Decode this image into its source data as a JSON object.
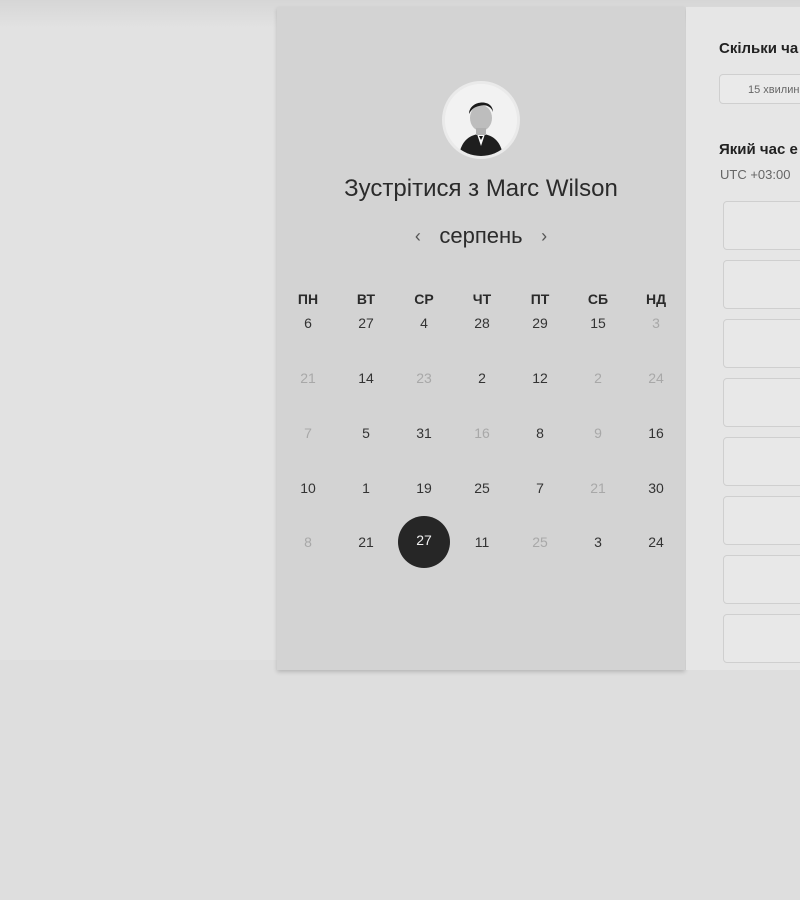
{
  "meeting": {
    "title_prefix": "Зустрітися з",
    "host_name": "Marc Wilson"
  },
  "calendar": {
    "month": "серпень",
    "prev_icon": "chevron-left-icon",
    "next_icon": "chevron-right-icon",
    "weekdays": [
      "ПН",
      "ВТ",
      "СР",
      "ЧТ",
      "ПТ",
      "СБ",
      "НД"
    ],
    "weeks": [
      [
        {
          "d": "6",
          "m": false
        },
        {
          "d": "27",
          "m": false
        },
        {
          "d": "4",
          "m": false
        },
        {
          "d": "28",
          "m": false
        },
        {
          "d": "29",
          "m": false
        },
        {
          "d": "15",
          "m": false
        },
        {
          "d": "3",
          "m": true
        }
      ],
      [
        {
          "d": "21",
          "m": true
        },
        {
          "d": "14",
          "m": false
        },
        {
          "d": "23",
          "m": true
        },
        {
          "d": "2",
          "m": false
        },
        {
          "d": "12",
          "m": false
        },
        {
          "d": "2",
          "m": true
        },
        {
          "d": "24",
          "m": true
        }
      ],
      [
        {
          "d": "7",
          "m": true
        },
        {
          "d": "5",
          "m": false
        },
        {
          "d": "31",
          "m": false
        },
        {
          "d": "16",
          "m": true
        },
        {
          "d": "8",
          "m": false
        },
        {
          "d": "9",
          "m": true
        },
        {
          "d": "16",
          "m": false
        }
      ],
      [
        {
          "d": "10",
          "m": false
        },
        {
          "d": "1",
          "m": false
        },
        {
          "d": "19",
          "m": false
        },
        {
          "d": "25",
          "m": false
        },
        {
          "d": "7",
          "m": false
        },
        {
          "d": "21",
          "m": true
        },
        {
          "d": "30",
          "m": false
        }
      ],
      [
        {
          "d": "8",
          "m": true
        },
        {
          "d": "21",
          "m": false
        },
        {
          "d": "27",
          "m": false,
          "selected": true
        },
        {
          "d": "11",
          "m": false
        },
        {
          "d": "25",
          "m": true
        },
        {
          "d": "3",
          "m": false
        },
        {
          "d": "24",
          "m": false
        }
      ]
    ]
  },
  "right_panel": {
    "duration_heading": "Скільки ча",
    "duration_value": "15 хвилин",
    "time_heading": "Який час е",
    "timezone": "UTC +03:00"
  },
  "colors": {
    "selected_day_bg": "#262626",
    "muted_day": "#a8a8a8"
  }
}
